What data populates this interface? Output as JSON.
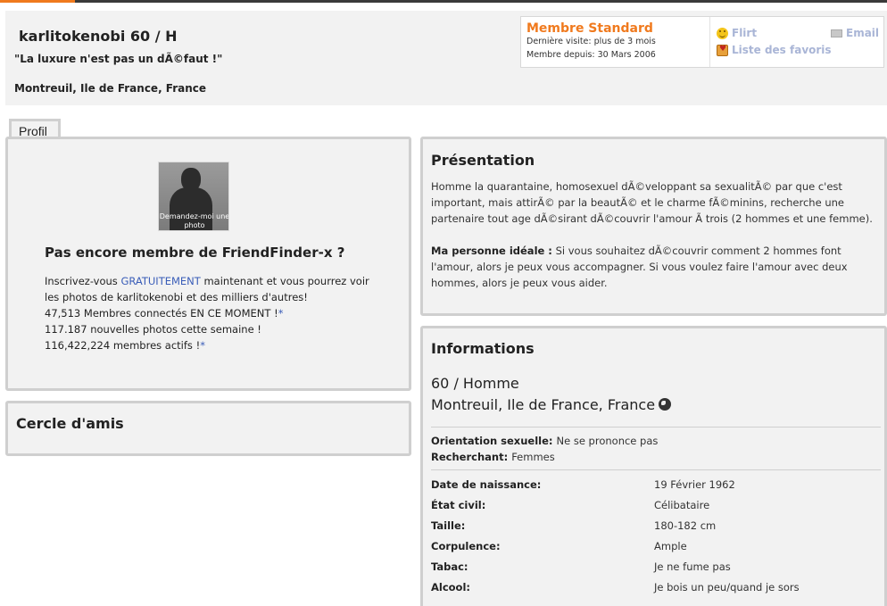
{
  "header": {
    "name_line": "karlitokenobi 60 / H",
    "motto": "\"La luxure n'est pas un dÃ©faut !\"",
    "location": "Montreuil, Ile de France, France"
  },
  "member_box": {
    "title": "Membre Standard",
    "last_visit": "Dernière visite: plus de 3 mois",
    "member_since": "Membre depuis: 30 Mars 2006",
    "flirt_label": "Flirt",
    "favorites_label": "Liste des favoris",
    "email_label": "Email"
  },
  "tabs": {
    "profile": "Profil"
  },
  "profile_panel": {
    "avatar_caption": "Demandez-moi une photo",
    "promo_title": "Pas encore membre de FriendFinder-x ?",
    "promo_l1_a": "Inscrivez-vous ",
    "promo_l1_link": "GRATUITEMENT",
    "promo_l1_b": " maintenant et vous pourrez voir",
    "promo_l2": "les photos de karlitokenobi et des milliers d'autres!",
    "promo_l3": "47,513 Membres connectés EN CE MOMENT !",
    "promo_l4": "117.187 nouvelles photos cette semaine !",
    "promo_l5": "116,422,224 membres actifs !",
    "asterisk": "*"
  },
  "friends_panel": {
    "title": "Cercle d'amis"
  },
  "presentation": {
    "title": "Présentation",
    "text": "Homme la quarantaine, homosexuel dÃ©veloppant sa sexualitÃ© par que c'est important, mais attirÃ© par la beautÃ© et le charme fÃ©minins, recherche une partenaire tout age dÃ©sirant dÃ©couvrir l'amour Ã  trois (2 hommes et une femme).",
    "ideal_label": "Ma personne idéale :",
    "ideal_text": " Si vous souhaitez dÃ©couvrir comment 2 hommes font l'amour, alors je peux vous accompagner. Si vous voulez faire l'amour avec deux hommes, alors je peux vous aider."
  },
  "informations": {
    "title": "Informations",
    "age_gender": "60 / Homme",
    "location": "Montreuil, Ile de France, France",
    "orientation_label": "Orientation sexuelle:",
    "orientation_value": "Ne se prononce pas",
    "seeking_label": "Recherchant:",
    "seeking_value": "Femmes",
    "details": [
      {
        "label": "Date de naissance:",
        "value": "19 Février 1962"
      },
      {
        "label": "État civil:",
        "value": "Célibataire"
      },
      {
        "label": "Taille:",
        "value": "180-182 cm"
      },
      {
        "label": "Corpulence:",
        "value": "Ample"
      },
      {
        "label": "Tabac:",
        "value": "Je ne fume pas"
      },
      {
        "label": "Alcool:",
        "value": "Je bois un peu/quand je sors"
      }
    ]
  }
}
